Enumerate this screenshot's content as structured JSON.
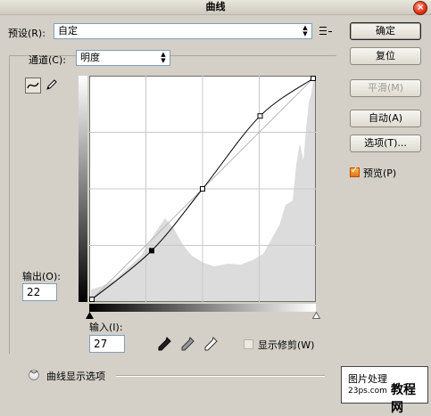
{
  "window": {
    "title": "曲线"
  },
  "preset": {
    "label": "预设(R):",
    "value": "自定"
  },
  "channel": {
    "label": "通道(C):",
    "value": "明度"
  },
  "buttons": {
    "ok": "确定",
    "reset": "复位",
    "smooth": "平滑(M)",
    "auto": "自动(A)",
    "options": "选项(T)..."
  },
  "preview": {
    "label": "预览(P)",
    "checked": true
  },
  "output": {
    "label": "输出(O):",
    "value": "22"
  },
  "input": {
    "label": "输入(I):",
    "value": "27"
  },
  "clipping": {
    "label": "显示修剪(W)",
    "checked": false
  },
  "curve_display_options": {
    "label": "曲线显示选项"
  },
  "icons": {
    "curve_tool": "curve-point-icon",
    "pencil_tool": "pencil-icon",
    "black_eyedropper": "eyedropper-black-icon",
    "gray_eyedropper": "eyedropper-gray-icon",
    "white_eyedropper": "eyedropper-white-icon",
    "preset_menu": "menu-list-icon",
    "expander": "chevron-double-down-icon",
    "close": "close-icon"
  },
  "curve": {
    "points": [
      [
        0,
        0
      ],
      [
        27,
        22
      ],
      [
        50,
        50
      ],
      [
        76,
        83
      ],
      [
        100,
        100
      ]
    ],
    "selected_point": 1
  },
  "watermark": {
    "line1": "图片处理",
    "line2": "23ps.com",
    "line3": "教程网"
  },
  "colors": {
    "accent_checkbox": "#e2761b",
    "close_button": "#e03218"
  }
}
